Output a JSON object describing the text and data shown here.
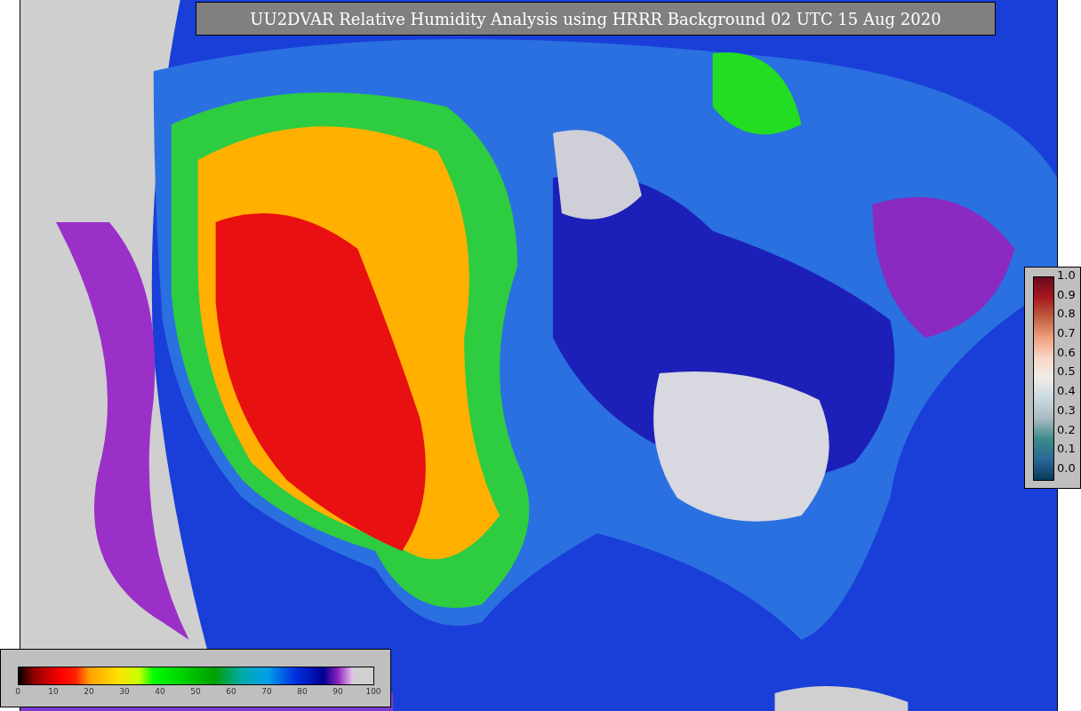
{
  "title": "UU2DVAR Relative Humidity Analysis using HRRR Background 02 UTC 15 Aug 2020",
  "humidity_colorbar": {
    "ticks": [
      "0",
      "10",
      "20",
      "30",
      "40",
      "50",
      "60",
      "70",
      "80",
      "90",
      "100"
    ]
  },
  "ratio_colorbar": {
    "ticks": [
      "1.0",
      "0.9",
      "0.8",
      "0.7",
      "0.6",
      "0.5",
      "0.4",
      "0.3",
      "0.2",
      "0.1",
      "0.0"
    ]
  }
}
